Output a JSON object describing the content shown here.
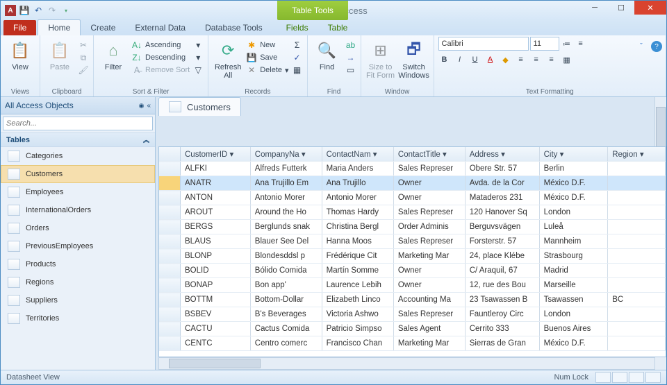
{
  "title": "Microsoft Access",
  "table_tools": "Table Tools",
  "tabs": {
    "file": "File",
    "home": "Home",
    "create": "Create",
    "external": "External Data",
    "dbtools": "Database Tools",
    "fields": "Fields",
    "table": "Table"
  },
  "ribbon": {
    "views": {
      "label": "Views",
      "view": "View"
    },
    "clipboard": {
      "label": "Clipboard",
      "paste": "Paste"
    },
    "sortfilter": {
      "label": "Sort & Filter",
      "filter": "Filter",
      "asc": "Ascending",
      "desc": "Descending",
      "remove": "Remove Sort"
    },
    "records": {
      "label": "Records",
      "refresh": "Refresh\nAll",
      "new": "New",
      "save": "Save",
      "delete": "Delete"
    },
    "find": {
      "label": "Find",
      "find": "Find"
    },
    "window": {
      "label": "Window",
      "size": "Size to\nFit Form",
      "switch": "Switch\nWindows"
    },
    "textfmt": {
      "label": "Text Formatting",
      "font": "Calibri",
      "size": "11"
    }
  },
  "nav": {
    "title": "All Access Objects",
    "search_ph": "Search...",
    "group": "Tables",
    "items": [
      "Categories",
      "Customers",
      "Employees",
      "InternationalOrders",
      "Orders",
      "PreviousEmployees",
      "Products",
      "Regions",
      "Suppliers",
      "Territories"
    ],
    "selected": 1
  },
  "datasheet": {
    "tab": "Customers",
    "columns": [
      "CustomerID",
      "CompanyNa",
      "ContactNam",
      "ContactTitle",
      "Address",
      "City",
      "Region"
    ],
    "rows": [
      [
        "ALFKI",
        "Alfreds Futterk",
        "Maria Anders",
        "Sales Represer",
        "Obere Str. 57",
        "Berlin",
        ""
      ],
      [
        "ANATR",
        "Ana Trujillo Em",
        "Ana Trujillo",
        "Owner",
        "Avda. de la Cor",
        "México D.F.",
        ""
      ],
      [
        "ANTON",
        "Antonio Morer",
        "Antonio Morer",
        "Owner",
        "Mataderos  231",
        "México D.F.",
        ""
      ],
      [
        "AROUT",
        "Around the Ho",
        "Thomas Hardy",
        "Sales Represer",
        "120 Hanover Sq",
        "London",
        ""
      ],
      [
        "BERGS",
        "Berglunds snak",
        "Christina Bergl",
        "Order Adminis",
        "Berguvsvägen",
        "Luleå",
        ""
      ],
      [
        "BLAUS",
        "Blauer See Del",
        "Hanna Moos",
        "Sales Represer",
        "Forsterstr. 57",
        "Mannheim",
        ""
      ],
      [
        "BLONP",
        "Blondesddsl p",
        "Frédérique Cit",
        "Marketing Mar",
        "24, place Klébe",
        "Strasbourg",
        ""
      ],
      [
        "BOLID",
        "Bólido Comida",
        "Martín Somme",
        "Owner",
        "C/ Araquil, 67",
        "Madrid",
        ""
      ],
      [
        "BONAP",
        "Bon app'",
        "Laurence Lebih",
        "Owner",
        "12, rue des Bou",
        "Marseille",
        ""
      ],
      [
        "BOTTM",
        "Bottom-Dollar",
        "Elizabeth Linco",
        "Accounting Ma",
        "23 Tsawassen B",
        "Tsawassen",
        "BC"
      ],
      [
        "BSBEV",
        "B's Beverages",
        "Victoria Ashwo",
        "Sales Represer",
        "Fauntleroy Circ",
        "London",
        ""
      ],
      [
        "CACTU",
        "Cactus Comida",
        "Patricio Simpso",
        "Sales Agent",
        "Cerrito 333",
        "Buenos Aires",
        ""
      ],
      [
        "CENTC",
        "Centro comerc",
        "Francisco Chan",
        "Marketing Mar",
        "Sierras de Gran",
        "México D.F.",
        ""
      ]
    ],
    "selected_row": 1
  },
  "status": {
    "left": "Datasheet View",
    "right": "Num Lock"
  }
}
